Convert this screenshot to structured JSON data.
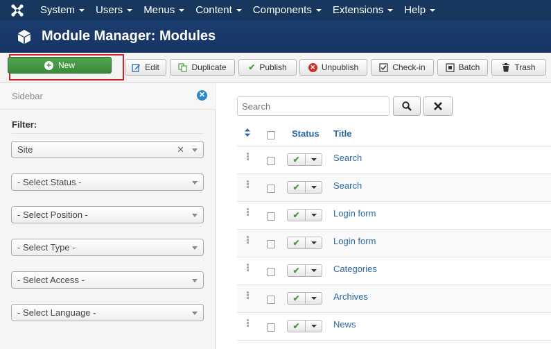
{
  "topnav": {
    "items": [
      {
        "label": "System"
      },
      {
        "label": "Users"
      },
      {
        "label": "Menus"
      },
      {
        "label": "Content"
      },
      {
        "label": "Components"
      },
      {
        "label": "Extensions"
      },
      {
        "label": "Help"
      }
    ]
  },
  "header": {
    "title": "Module Manager: Modules"
  },
  "toolbar": {
    "new_label": "New",
    "edit_label": "Edit",
    "duplicate_label": "Duplicate",
    "publish_label": "Publish",
    "unpublish_label": "Unpublish",
    "checkin_label": "Check-in",
    "batch_label": "Batch",
    "trash_label": "Trash"
  },
  "sidebar": {
    "title": "Sidebar",
    "filter_label": "Filter:",
    "selects": [
      {
        "value": "Site"
      },
      {
        "value": "- Select Status -"
      },
      {
        "value": "- Select Position -"
      },
      {
        "value": "- Select Type -"
      },
      {
        "value": "- Select Access -"
      },
      {
        "value": "- Select Language -"
      }
    ]
  },
  "search": {
    "placeholder": "Search"
  },
  "table": {
    "headers": {
      "status": "Status",
      "title": "Title"
    },
    "rows": [
      {
        "title": "Search",
        "published": true
      },
      {
        "title": "Search",
        "published": true
      },
      {
        "title": "Login form",
        "published": true
      },
      {
        "title": "Login form",
        "published": true
      },
      {
        "title": "Categories",
        "published": true
      },
      {
        "title": "Archives",
        "published": true
      },
      {
        "title": "News",
        "published": true
      }
    ]
  },
  "colors": {
    "nav_bg": "#17375e",
    "new_button": "#46964a",
    "link": "#2a69a4",
    "highlight_border": "#d21f26"
  }
}
